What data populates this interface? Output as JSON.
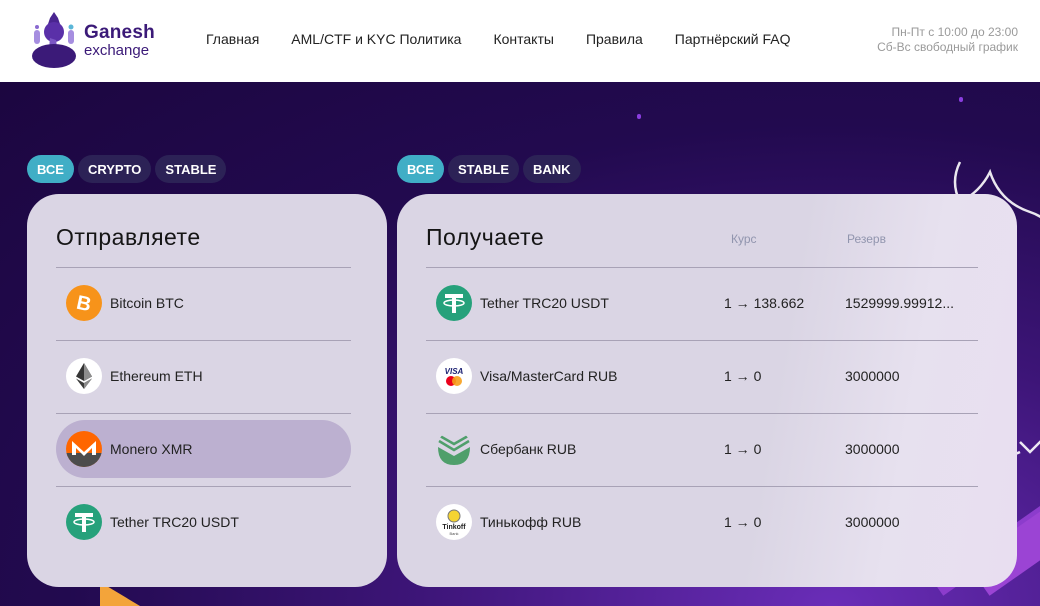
{
  "header": {
    "logo_title": "Ganesh",
    "logo_subtitle": "exchange",
    "nav": [
      "Главная",
      "AML/CTF и KYC Политика",
      "Контакты",
      "Правила",
      "Партнёрский FAQ"
    ],
    "hours_line1": "Пн-Пт с 10:00 до 23:00",
    "hours_line2": "Сб-Вс свободный график"
  },
  "send": {
    "filters": [
      {
        "label": "ВСЕ",
        "active": true
      },
      {
        "label": "CRYPTO",
        "active": false
      },
      {
        "label": "STABLE",
        "active": false
      }
    ],
    "title": "Отправляете",
    "items": [
      {
        "name": "Bitcoin BTC",
        "icon": "bitcoin-icon",
        "selected": false
      },
      {
        "name": "Ethereum ETH",
        "icon": "ethereum-icon",
        "selected": false
      },
      {
        "name": "Monero XMR",
        "icon": "monero-icon",
        "selected": true
      },
      {
        "name": "Tether TRC20 USDT",
        "icon": "tether-icon",
        "selected": false
      }
    ]
  },
  "receive": {
    "filters": [
      {
        "label": "ВСЕ",
        "active": true
      },
      {
        "label": "STABLE",
        "active": false
      },
      {
        "label": "BANK",
        "active": false
      }
    ],
    "title": "Получаете",
    "col_rate": "Курс",
    "col_reserve": "Резерв",
    "items": [
      {
        "name": "Tether TRC20 USDT",
        "icon": "tether-icon",
        "rate": "1 → 138.662",
        "reserve": "1529999.99912..."
      },
      {
        "name": "Visa/MasterCard RUB",
        "icon": "visa-mastercard-icon",
        "rate": "1 → 0",
        "reserve": "3000000"
      },
      {
        "name": "Сбербанк RUB",
        "icon": "sberbank-icon",
        "rate": "1 → 0",
        "reserve": "3000000"
      },
      {
        "name": "Тинькофф RUB",
        "icon": "tinkoff-icon",
        "rate": "1 → 0",
        "reserve": "3000000"
      }
    ]
  },
  "colors": {
    "brand": "#3b1a78",
    "pill_active": "#40aec6",
    "pill_inactive": "#2c2256",
    "card_bg": "#dad5e4",
    "selected_row": "#bcb0d0"
  }
}
